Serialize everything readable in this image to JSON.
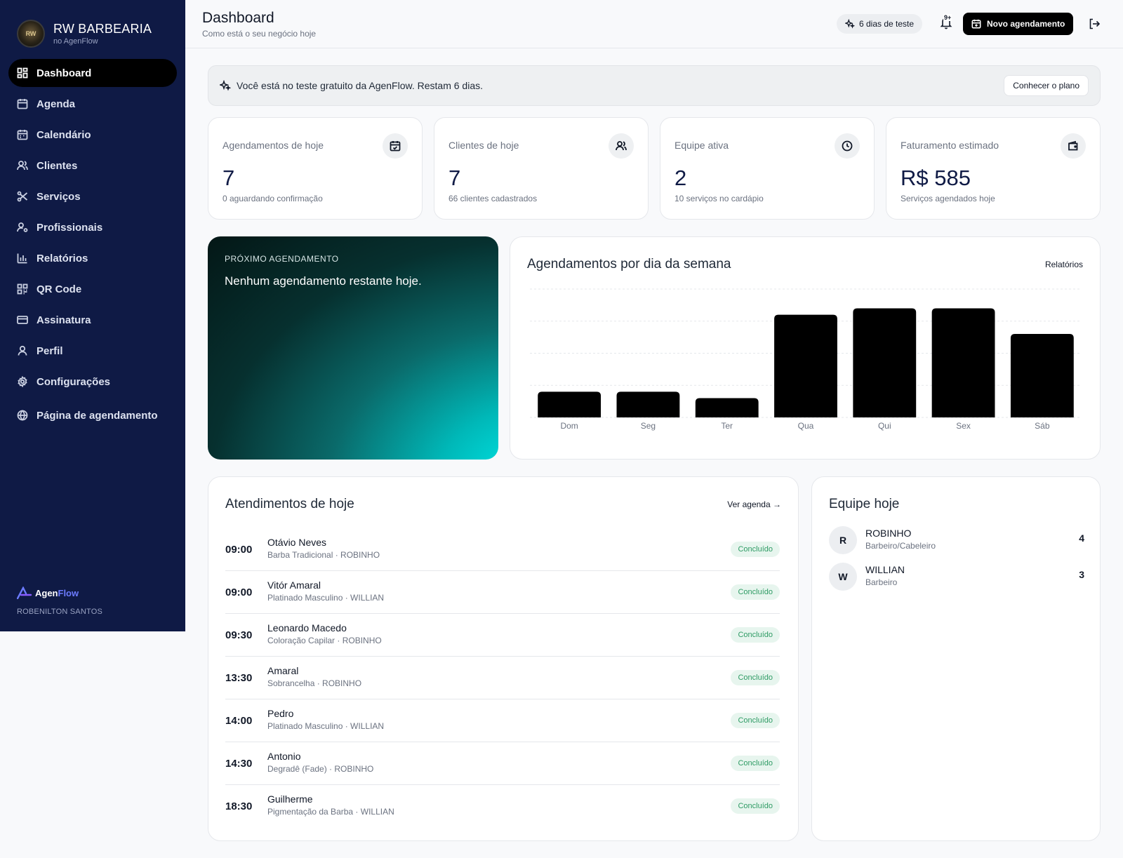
{
  "brand": {
    "name": "RW BARBEARIA",
    "sub": "no AgenFlow",
    "logo_text": "RW"
  },
  "sidebar": {
    "items": [
      {
        "label": "Dashboard",
        "icon": "dashboard-icon"
      },
      {
        "label": "Agenda",
        "icon": "calendar-icon"
      },
      {
        "label": "Calendário",
        "icon": "calendar-icon"
      },
      {
        "label": "Clientes",
        "icon": "users-icon"
      },
      {
        "label": "Serviços",
        "icon": "scissors-icon"
      },
      {
        "label": "Profissionais",
        "icon": "user-cog-icon"
      },
      {
        "label": "Relatórios",
        "icon": "bar-chart-icon"
      },
      {
        "label": "QR Code",
        "icon": "qr-code-icon"
      },
      {
        "label": "Assinatura",
        "icon": "credit-card-icon"
      },
      {
        "label": "Perfil",
        "icon": "user-icon"
      },
      {
        "label": "Configurações",
        "icon": "gear-icon"
      },
      {
        "label": "Página de agendamento",
        "icon": "globe-icon"
      }
    ],
    "footer": {
      "logo_agen": "Agen",
      "logo_flow": "Flow",
      "owner": "ROBENILTON SANTOS"
    }
  },
  "header": {
    "title": "Dashboard",
    "subtitle": "Como está o seu negócio hoje",
    "trial_pill": "6 dias de teste",
    "notification_badge": "9+",
    "new_button": "Novo agendamento"
  },
  "banner": {
    "text": "Você está no teste gratuito da AgenFlow. Restam 6 dias.",
    "button": "Conhecer o plano"
  },
  "stats": [
    {
      "label": "Agendamentos de hoje",
      "value": "7",
      "hint": "0 aguardando confirmação",
      "icon": "calendar-check-icon"
    },
    {
      "label": "Clientes de hoje",
      "value": "7",
      "hint": "66 clientes cadastrados",
      "icon": "users-icon"
    },
    {
      "label": "Equipe ativa",
      "value": "2",
      "hint": "10 serviços no cardápio",
      "icon": "clock-icon"
    },
    {
      "label": "Faturamento estimado",
      "value": "R$ 585",
      "hint": "Serviços agendados hoje",
      "icon": "wallet-icon"
    }
  ],
  "next_appointment": {
    "label": "PRÓXIMO AGENDAMENTO",
    "text": "Nenhum agendamento restante hoje."
  },
  "chart_data": {
    "type": "bar",
    "title": "Agendamentos por dia da semana",
    "link": "Relatórios",
    "categories": [
      "Dom",
      "Seg",
      "Ter",
      "Qua",
      "Qui",
      "Sex",
      "Sáb"
    ],
    "values": [
      4,
      4,
      3,
      16,
      17,
      17,
      13
    ],
    "ylim": [
      0,
      20
    ],
    "grid": true,
    "color": "#000000"
  },
  "appointments": {
    "title": "Atendimentos de hoje",
    "link": "Ver agenda →",
    "rows": [
      {
        "time": "09:00",
        "name": "Otávio Neves",
        "meta": "Barba Tradicional · ROBINHO",
        "status": "Concluído"
      },
      {
        "time": "09:00",
        "name": "Vitór Amaral",
        "meta": "Platinado Masculino · WILLIAN",
        "status": "Concluído"
      },
      {
        "time": "09:30",
        "name": "Leonardo Macedo",
        "meta": "Coloração Capilar · ROBINHO",
        "status": "Concluído"
      },
      {
        "time": "13:30",
        "name": "Amaral",
        "meta": "Sobrancelha · ROBINHO",
        "status": "Concluído"
      },
      {
        "time": "14:00",
        "name": "Pedro",
        "meta": "Platinado Masculino · WILLIAN",
        "status": "Concluído"
      },
      {
        "time": "14:30",
        "name": "Antonio",
        "meta": "Degradê (Fade) · ROBINHO",
        "status": "Concluído"
      },
      {
        "time": "18:30",
        "name": "Guilherme",
        "meta": "Pigmentação da Barba · WILLIAN",
        "status": "Concluído"
      }
    ]
  },
  "team": {
    "title": "Equipe hoje",
    "members": [
      {
        "initial": "R",
        "name": "ROBINHO",
        "role": "Barbeiro/Cabeleiro",
        "count": "4"
      },
      {
        "initial": "W",
        "name": "WILLIAN",
        "role": "Barbeiro",
        "count": "3"
      }
    ]
  }
}
